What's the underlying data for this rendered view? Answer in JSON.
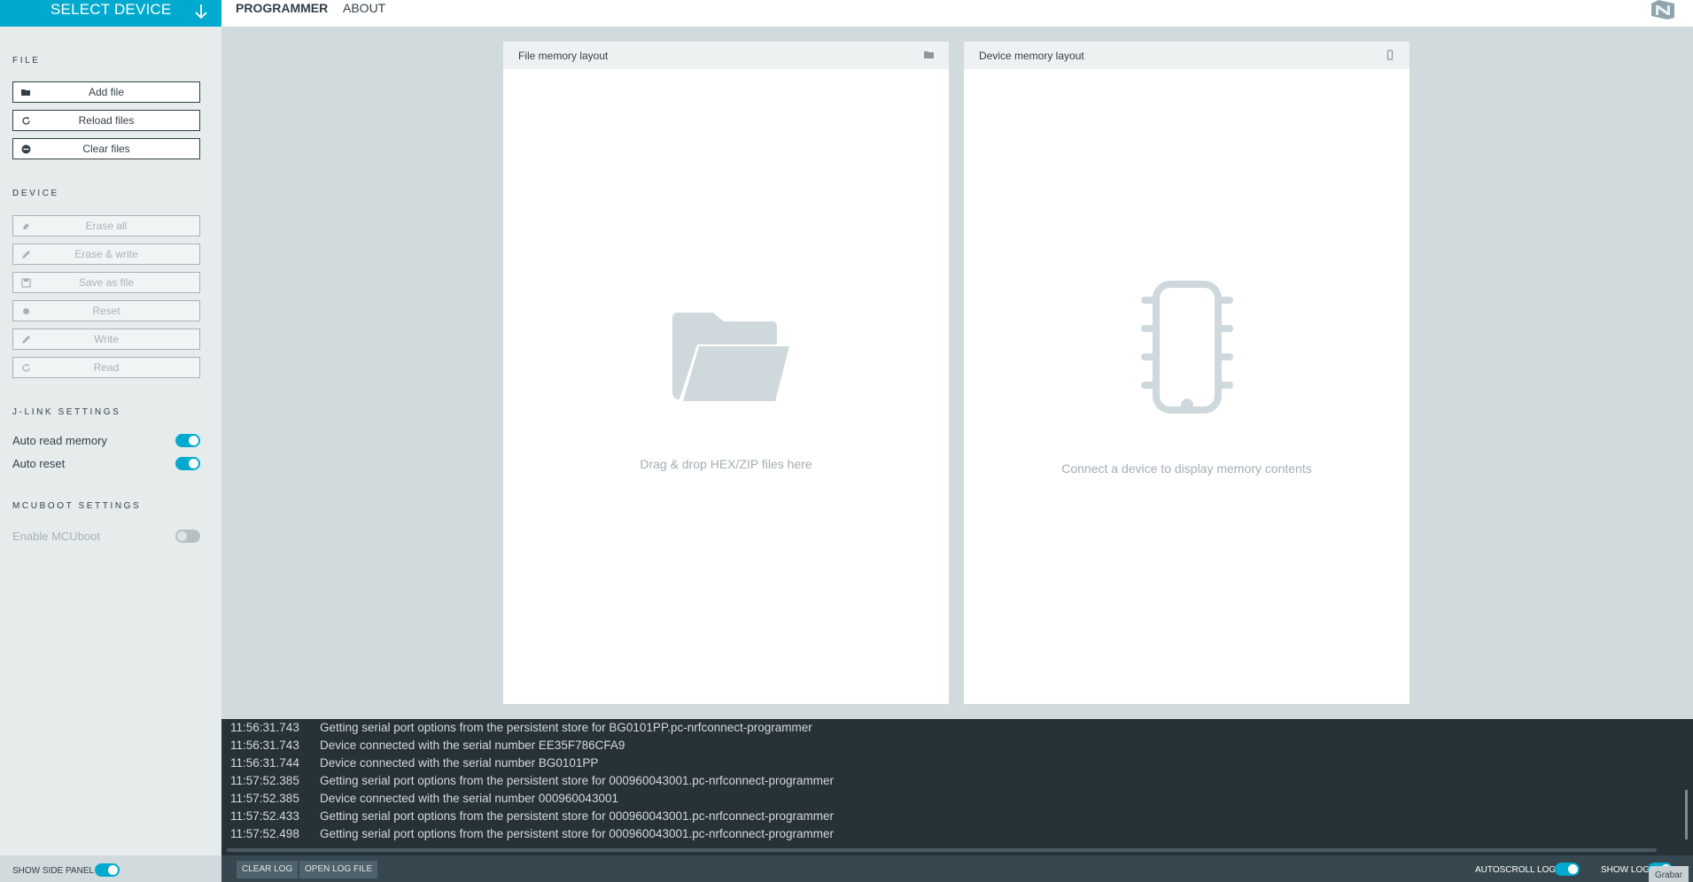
{
  "header": {
    "select_device_label": "SELECT DEVICE",
    "nav": [
      {
        "label": "PROGRAMMER",
        "active": true
      },
      {
        "label": "ABOUT",
        "active": false
      }
    ]
  },
  "sidebar": {
    "file_section": {
      "title": "FILE",
      "buttons": [
        {
          "label": "Add file",
          "icon": "folder-open-icon"
        },
        {
          "label": "Reload files",
          "icon": "refresh-icon"
        },
        {
          "label": "Clear files",
          "icon": "minus-circle-icon"
        }
      ]
    },
    "device_section": {
      "title": "DEVICE",
      "buttons": [
        {
          "label": "Erase all",
          "icon": "eraser-icon",
          "disabled": true
        },
        {
          "label": "Erase & write",
          "icon": "pencil-icon",
          "disabled": true
        },
        {
          "label": "Save as file",
          "icon": "save-icon",
          "disabled": true
        },
        {
          "label": "Reset",
          "icon": "dot-icon",
          "disabled": true
        },
        {
          "label": "Write",
          "icon": "pencil-icon",
          "disabled": true
        },
        {
          "label": "Read",
          "icon": "refresh-icon",
          "disabled": true
        }
      ]
    },
    "jlink_section": {
      "title": "J-LINK SETTINGS",
      "toggles": [
        {
          "label": "Auto read memory",
          "on": true
        },
        {
          "label": "Auto reset",
          "on": true
        }
      ]
    },
    "mcuboot_section": {
      "title": "MCUBOOT SETTINGS",
      "toggles": [
        {
          "label": "Enable MCUboot",
          "on": false,
          "disabled": true
        }
      ]
    }
  },
  "file_panel": {
    "title": "File memory layout",
    "placeholder": "Drag & drop HEX/ZIP files here"
  },
  "device_panel": {
    "title": "Device memory layout",
    "placeholder": "Connect a device to display memory contents"
  },
  "log": {
    "entries": [
      {
        "time": "11:56:31.743",
        "message": "Getting serial port options from the persistent store for BG0101PP.pc-nrfconnect-programmer"
      },
      {
        "time": "11:56:31.743",
        "message": "Device connected with the serial number EE35F786CFA9"
      },
      {
        "time": "11:56:31.744",
        "message": "Device connected with the serial number BG0101PP"
      },
      {
        "time": "11:57:52.385",
        "message": "Getting serial port options from the persistent store for 000960043001.pc-nrfconnect-programmer"
      },
      {
        "time": "11:57:52.385",
        "message": "Device connected with the serial number 000960043001"
      },
      {
        "time": "11:57:52.433",
        "message": "Getting serial port options from the persistent store for 000960043001.pc-nrfconnect-programmer"
      },
      {
        "time": "11:57:52.498",
        "message": "Getting serial port options from the persistent store for 000960043001.pc-nrfconnect-programmer"
      }
    ]
  },
  "footer": {
    "show_side_panel_label": "SHOW SIDE PANEL",
    "clear_log_label": "CLEAR LOG",
    "open_log_file_label": "OPEN LOG FILE",
    "autoscroll_log_label": "AUTOSCROLL LOG",
    "show_log_label": "SHOW LOG",
    "grabar_label": "Grabar"
  },
  "colors": {
    "accent": "#00a9ce",
    "log_background": "#263238",
    "main_background": "#d1dadd"
  }
}
